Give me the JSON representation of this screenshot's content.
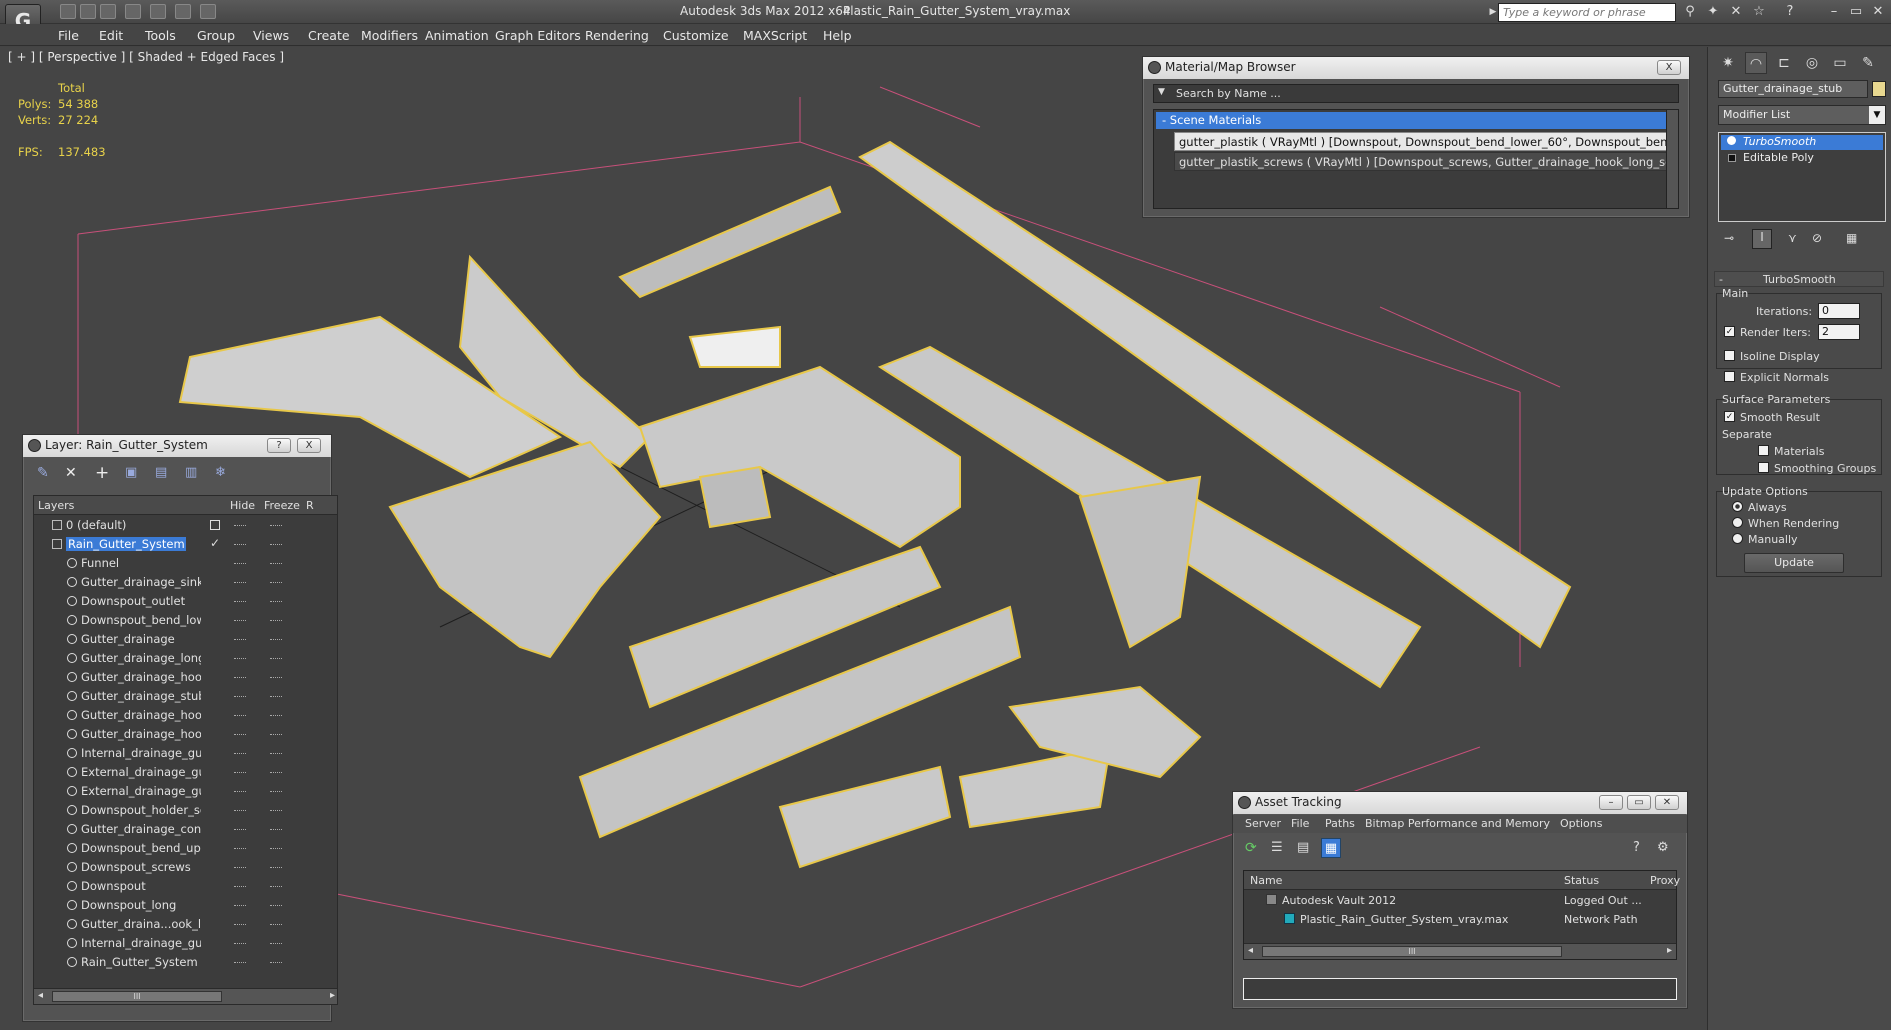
{
  "app": {
    "title": "Autodesk 3ds Max  2012 x64",
    "file": "Plastic_Rain_Gutter_System_vray.max",
    "search_placeholder": "Type a keyword or phrase",
    "logo": "G"
  },
  "menu": [
    "File",
    "Edit",
    "Tools",
    "Group",
    "Views",
    "Create",
    "Modifiers",
    "Animation",
    "Graph Editors",
    "Rendering",
    "Customize",
    "MAXScript",
    "Help"
  ],
  "viewport": {
    "label": "[ + ] [ Perspective ] [ Shaded + Edged Faces ]",
    "stats_header": "Total",
    "polys_label": "Polys:",
    "polys_value": "54 388",
    "verts_label": "Verts:",
    "verts_value": "27 224",
    "fps_label": "FPS:",
    "fps_value": "137.483"
  },
  "layer_window": {
    "title": "Layer: Rain_Gutter_System",
    "help_btn": "?",
    "close_btn": "X",
    "col_layers": "Layers",
    "col_hide": "Hide",
    "col_freeze": "Freeze",
    "col_r": "R",
    "layers": [
      "0 (default)",
      "Rain_Gutter_System"
    ],
    "objects": [
      "Funnel",
      "Gutter_drainage_sink",
      "Downspout_outlet",
      "Downspout_bend_lowe",
      "Gutter_drainage",
      "Gutter_drainage_long",
      "Gutter_drainage_hook_",
      "Gutter_drainage_stub",
      "Gutter_drainage_hook",
      "Gutter_drainage_hook_",
      "Internal_drainage_gutt",
      "External_drainage_gut",
      "External_drainage_gut",
      "Downspout_holder_scr",
      "Gutter_drainage_conne",
      "Downspout_bend_uppe",
      "Downspout_screws",
      "Downspout",
      "Downspout_long",
      "Gutter_draina...ook_lo",
      "Internal_drainage_gutt",
      "Rain_Gutter_System"
    ],
    "scroll_mark": "III"
  },
  "material_browser": {
    "title": "Material/Map Browser",
    "close_btn": "X",
    "search": "Search by Name ...",
    "group": "- Scene Materials",
    "materials": [
      "gutter_plastik  ( VRayMtl ) [Downspout, Downspout_bend_lower_60°, Downspout_bend_upper...",
      "gutter_plastik_screws  ( VRayMtl ) [Downspout_screws, Gutter_drainage_hook_long_screw, Gut..."
    ]
  },
  "asset_tracking": {
    "title": "Asset Tracking",
    "menu": [
      "Server",
      "File",
      "Paths",
      "Bitmap Performance and Memory",
      "Options"
    ],
    "col_name": "Name",
    "col_status": "Status",
    "col_proxy": "Proxy",
    "rows": [
      {
        "name": "Autodesk Vault 2012",
        "status": "Logged Out ..."
      },
      {
        "name": "Plastic_Rain_Gutter_System_vray.max",
        "status": "Network Path"
      }
    ],
    "scroll_mark": "III"
  },
  "command_panel": {
    "object_name": "Gutter_drainage_stub",
    "modifier_list": "Modifier List",
    "stack": [
      "TurboSmooth",
      "Editable Poly"
    ],
    "rollout_title": "TurboSmooth",
    "main": "Main",
    "iterations_label": "Iterations:",
    "iterations_value": "0",
    "render_iters_label": "Render Iters:",
    "render_iters_value": "2",
    "isoline": "Isoline Display",
    "explicit": "Explicit Normals",
    "surface_params": "Surface Parameters",
    "smooth_result": "Smooth Result",
    "separate": "Separate",
    "materials": "Materials",
    "smoothing_groups": "Smoothing Groups",
    "update_options": "Update Options",
    "always": "Always",
    "when_rendering": "When Rendering",
    "manually": "Manually",
    "update_btn": "Update",
    "minus": "-"
  },
  "colors": {
    "wire": "#e8c84a",
    "selection": "#3b7bd6",
    "background": "#454545"
  }
}
